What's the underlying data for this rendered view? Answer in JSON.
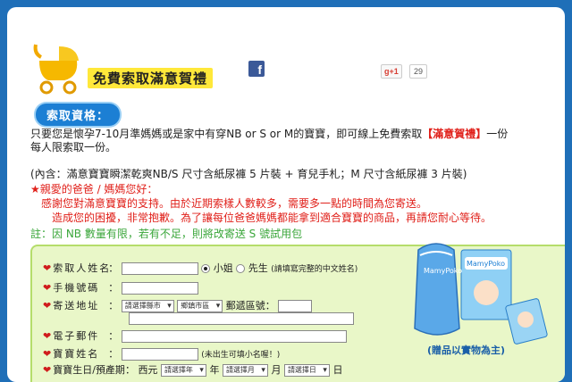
{
  "header": {
    "title": "免費索取滿意賀禮",
    "gplus_label": "+1",
    "gplus_count": "29"
  },
  "qualification": {
    "tag": "索取資格：",
    "line1_a": "只要您是懷孕7-10月準媽媽或是家中有穿NB or S or M的寶寶，即可線上免費索取",
    "line1_red": "【滿意賀禮】",
    "line1_b": "一份",
    "line2": "每人限索取一份。",
    "line3": "(內含：滿意寶寶瞬潔乾爽NB/S 尺寸含紙尿褲 5 片裝 + 育兒手札；M 尺寸含紙尿褲 3 片裝)"
  },
  "notice": {
    "greeting": "★親愛的爸爸 / 媽媽您好：",
    "line1": "感謝您對滿意寶寶的支持。由於近期索樣人數較多，需要多一點的時間為您寄送。",
    "line2": "造成您的困擾，非常抱歉。為了讓每位爸爸媽媽都能拿到適合寶寶的商品，再請您耐心等待。",
    "note": "註：因 NB 數量有限，若有不足，則將改寄送 S 號試用包"
  },
  "form": {
    "name_label": "索取人姓名",
    "miss": "小姐",
    "mr": "先生",
    "name_hint": "(請填寫完整的中文姓名)",
    "phone_label": "手機號碼",
    "address_label": "寄送地址",
    "city_select": "請選擇縣市",
    "district_select": "鄉鎮市區",
    "zip_label": "郵遞區號：",
    "email_label": "電子郵件",
    "baby_label": "寶寶姓名",
    "baby_hint": "(未出生可填小名喔！)",
    "birth_label": "寶寶生日/預產期",
    "era": "西元",
    "year_select": "請選擇年",
    "year_unit": "年",
    "month_select": "請選擇月",
    "month_unit": "月",
    "day_select": "請選擇日",
    "day_unit": "日"
  },
  "product": {
    "brand": "MamyPoko",
    "gift_note": "(贈品以實物為主)"
  },
  "colors": {
    "accent_blue": "#1c7fd4",
    "title_yellow": "#ffe83a",
    "alert_red": "#e0201a",
    "form_green": "#e9f7c8"
  }
}
